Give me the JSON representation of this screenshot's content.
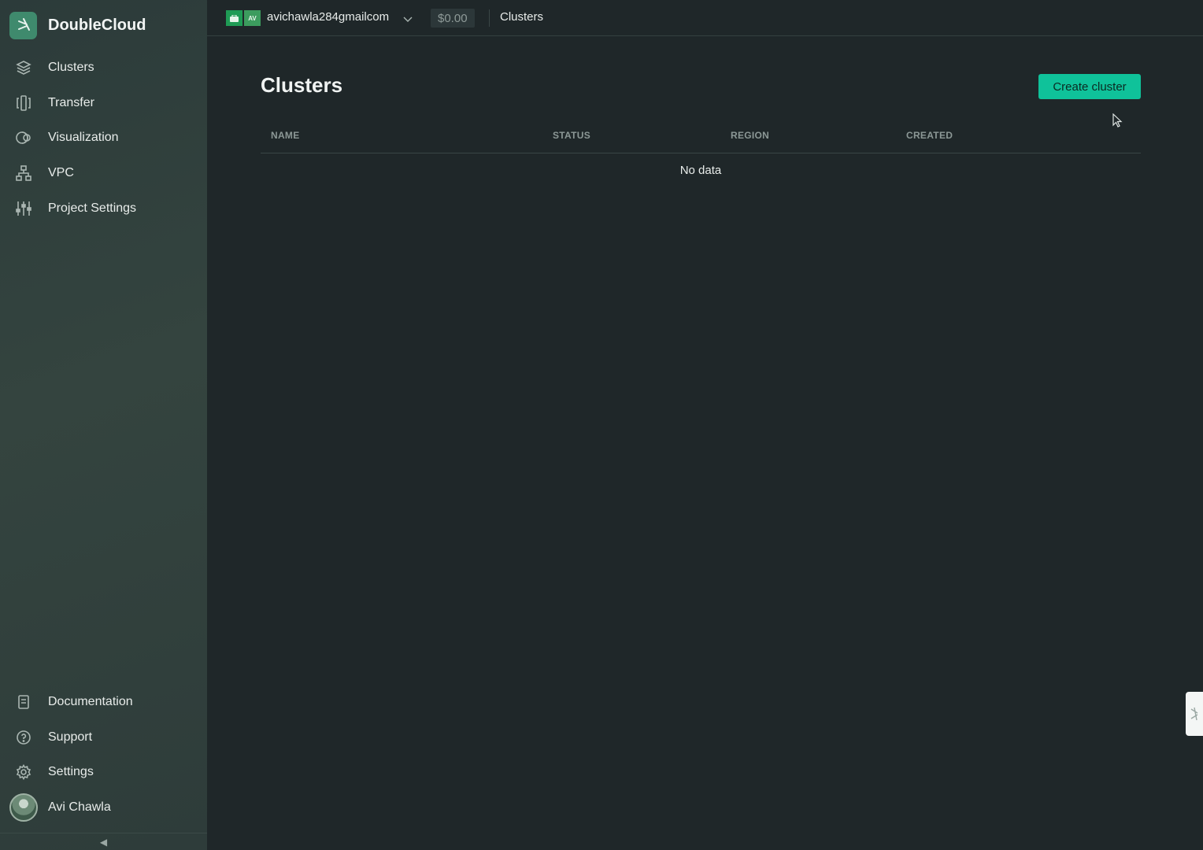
{
  "brand": {
    "name": "DoubleCloud"
  },
  "sidebar": {
    "nav": [
      {
        "label": "Clusters",
        "icon": "layers-icon"
      },
      {
        "label": "Transfer",
        "icon": "transfer-icon"
      },
      {
        "label": "Visualization",
        "icon": "visualization-icon"
      },
      {
        "label": "VPC",
        "icon": "network-icon"
      },
      {
        "label": "Project Settings",
        "icon": "sliders-icon"
      }
    ],
    "footer": [
      {
        "label": "Documentation",
        "icon": "book-icon"
      },
      {
        "label": "Support",
        "icon": "help-circle-icon"
      },
      {
        "label": "Settings",
        "icon": "gear-icon"
      }
    ],
    "user": {
      "name": "Avi Chawla"
    },
    "collapse_glyph": "◀"
  },
  "topbar": {
    "project_badge": "AV",
    "account": "avichawla284gmailcom",
    "balance": "$0.00",
    "breadcrumb": "Clusters"
  },
  "main": {
    "title": "Clusters",
    "create_button": "Create cluster",
    "table": {
      "columns": [
        "NAME",
        "STATUS",
        "REGION",
        "CREATED"
      ],
      "rows": [],
      "empty_text": "No data"
    }
  },
  "colors": {
    "accent": "#0fc29a",
    "background": "#1f2729",
    "sidebar": "#34443f"
  }
}
